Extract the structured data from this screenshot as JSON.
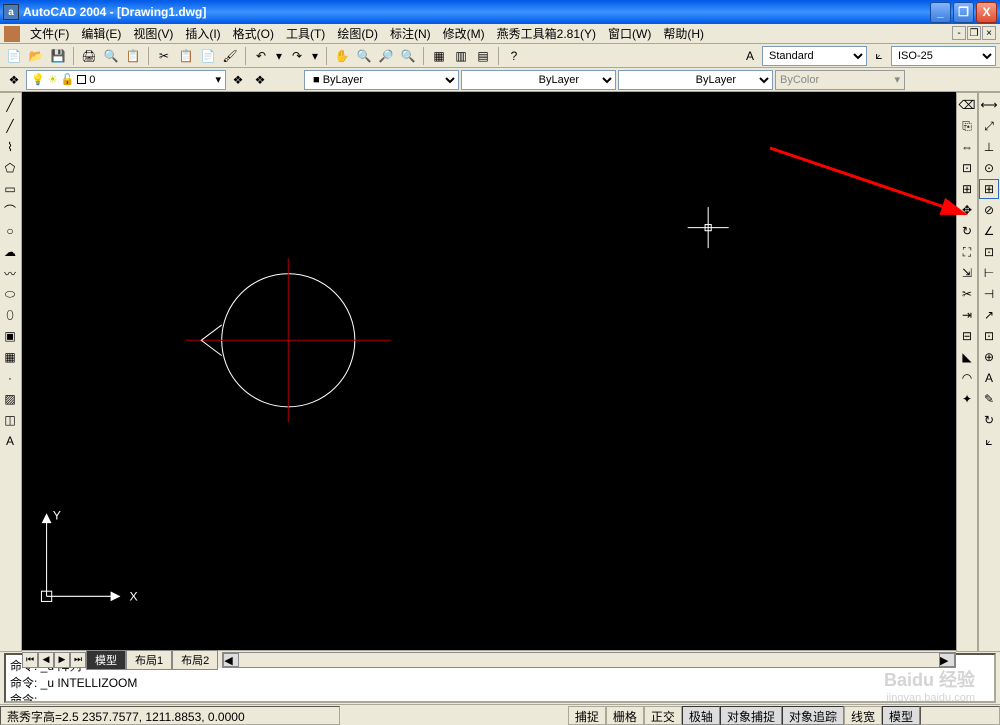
{
  "title": "AutoCAD 2004 - [Drawing1.dwg]",
  "app_icon_letter": "a",
  "menu": {
    "file": "文件(F)",
    "edit": "编辑(E)",
    "view": "视图(V)",
    "insert": "插入(I)",
    "format": "格式(O)",
    "tools": "工具(T)",
    "draw": "绘图(D)",
    "dimension": "标注(N)",
    "modify": "修改(M)",
    "yanxiu": "燕秀工具箱2.81(Y)",
    "window": "窗口(W)",
    "help": "帮助(H)"
  },
  "style_combo": "Standard",
  "dim_combo": "ISO-25",
  "layer_name": "0",
  "prop": {
    "bylayer1": "ByLayer",
    "bylayer2": "ByLayer",
    "bylayer3": "ByLayer",
    "bycolor": "ByColor"
  },
  "tabs": {
    "model": "模型",
    "layout1": "布局1",
    "layout2": "布局2"
  },
  "cmd": {
    "line1": "命令: _u 阵列 GROUP",
    "line2": "命令: _u INTELLIZOOM",
    "prompt": "命令:"
  },
  "status": {
    "coords": "燕秀字高=2.5  2357.7577, 1211.8853, 0.0000",
    "snap": "捕捉",
    "grid": "栅格",
    "ortho": "正交",
    "polar": "极轴",
    "osnap": "对象捕捉",
    "otrack": "对象追踪",
    "lwt": "线宽",
    "model": "模型"
  },
  "axis": {
    "x": "X",
    "y": "Y"
  },
  "watermark": {
    "main": "Baidu 经验",
    "sub": "jingyan.baidu.com"
  }
}
